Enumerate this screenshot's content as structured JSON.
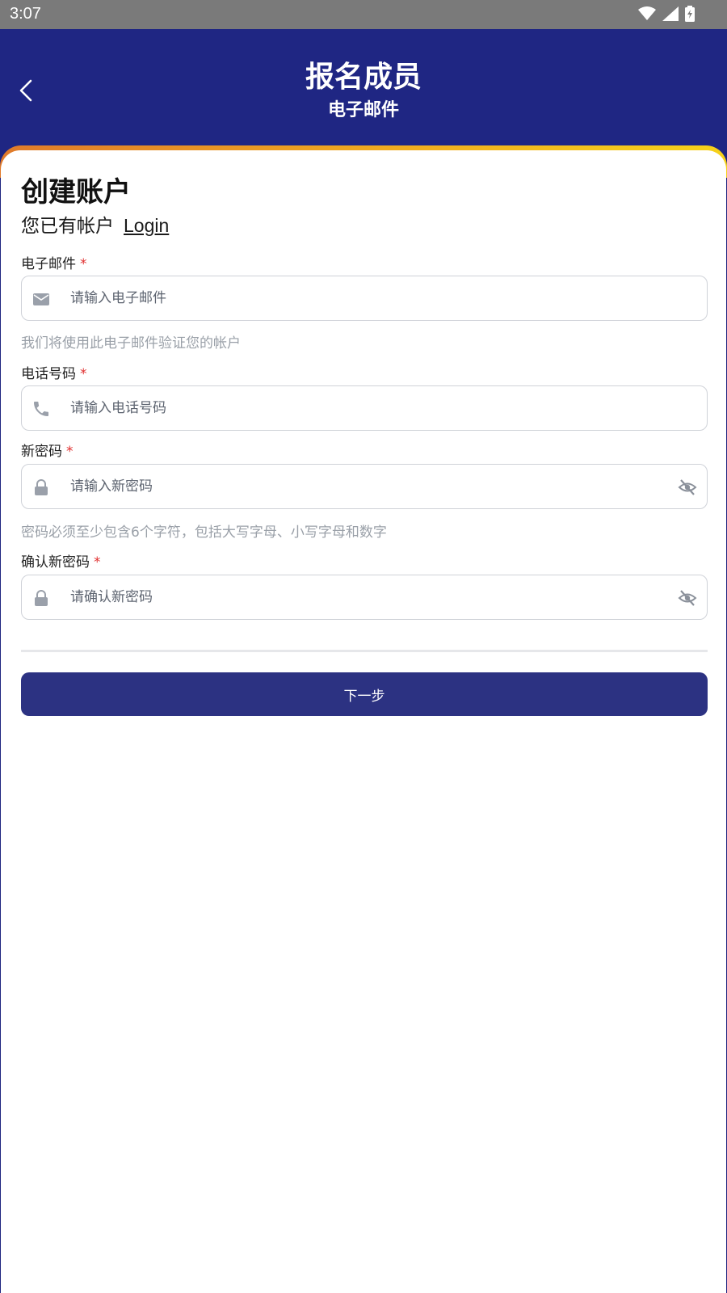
{
  "status_bar": {
    "time": "3:07"
  },
  "header": {
    "title": "报名成员",
    "subtitle": "电子邮件"
  },
  "form": {
    "title": "创建账户",
    "have_account": "您已有帐户",
    "login_link": "Login",
    "email": {
      "label": "电子邮件",
      "required_mark": "*",
      "placeholder": "请输入电子邮件",
      "value": "",
      "helper": "我们将使用此电子邮件验证您的帐户"
    },
    "phone": {
      "label": "电话号码",
      "required_mark": "*",
      "placeholder": "请输入电话号码",
      "value": ""
    },
    "new_password": {
      "label": "新密码",
      "required_mark": "*",
      "placeholder": "请输入新密码",
      "value": "",
      "helper": "密码必须至少包含6个字符，包括大写字母、小写字母和数字"
    },
    "confirm_password": {
      "label": "确认新密码",
      "required_mark": "*",
      "placeholder": "请确认新密码",
      "value": ""
    },
    "next_button": "下一步"
  },
  "icons": {
    "back": "chevron-left-icon",
    "email": "envelope-icon",
    "phone": "phone-icon",
    "lock": "lock-icon",
    "eye": "eye-slash-icon"
  },
  "colors": {
    "header_bg": "#1f2683",
    "accent_gradient": [
      "#e07a2a",
      "#f6d21a"
    ],
    "button_bg": "#2c3282",
    "required": "#e03030",
    "helper_text": "#9aa0a8"
  }
}
